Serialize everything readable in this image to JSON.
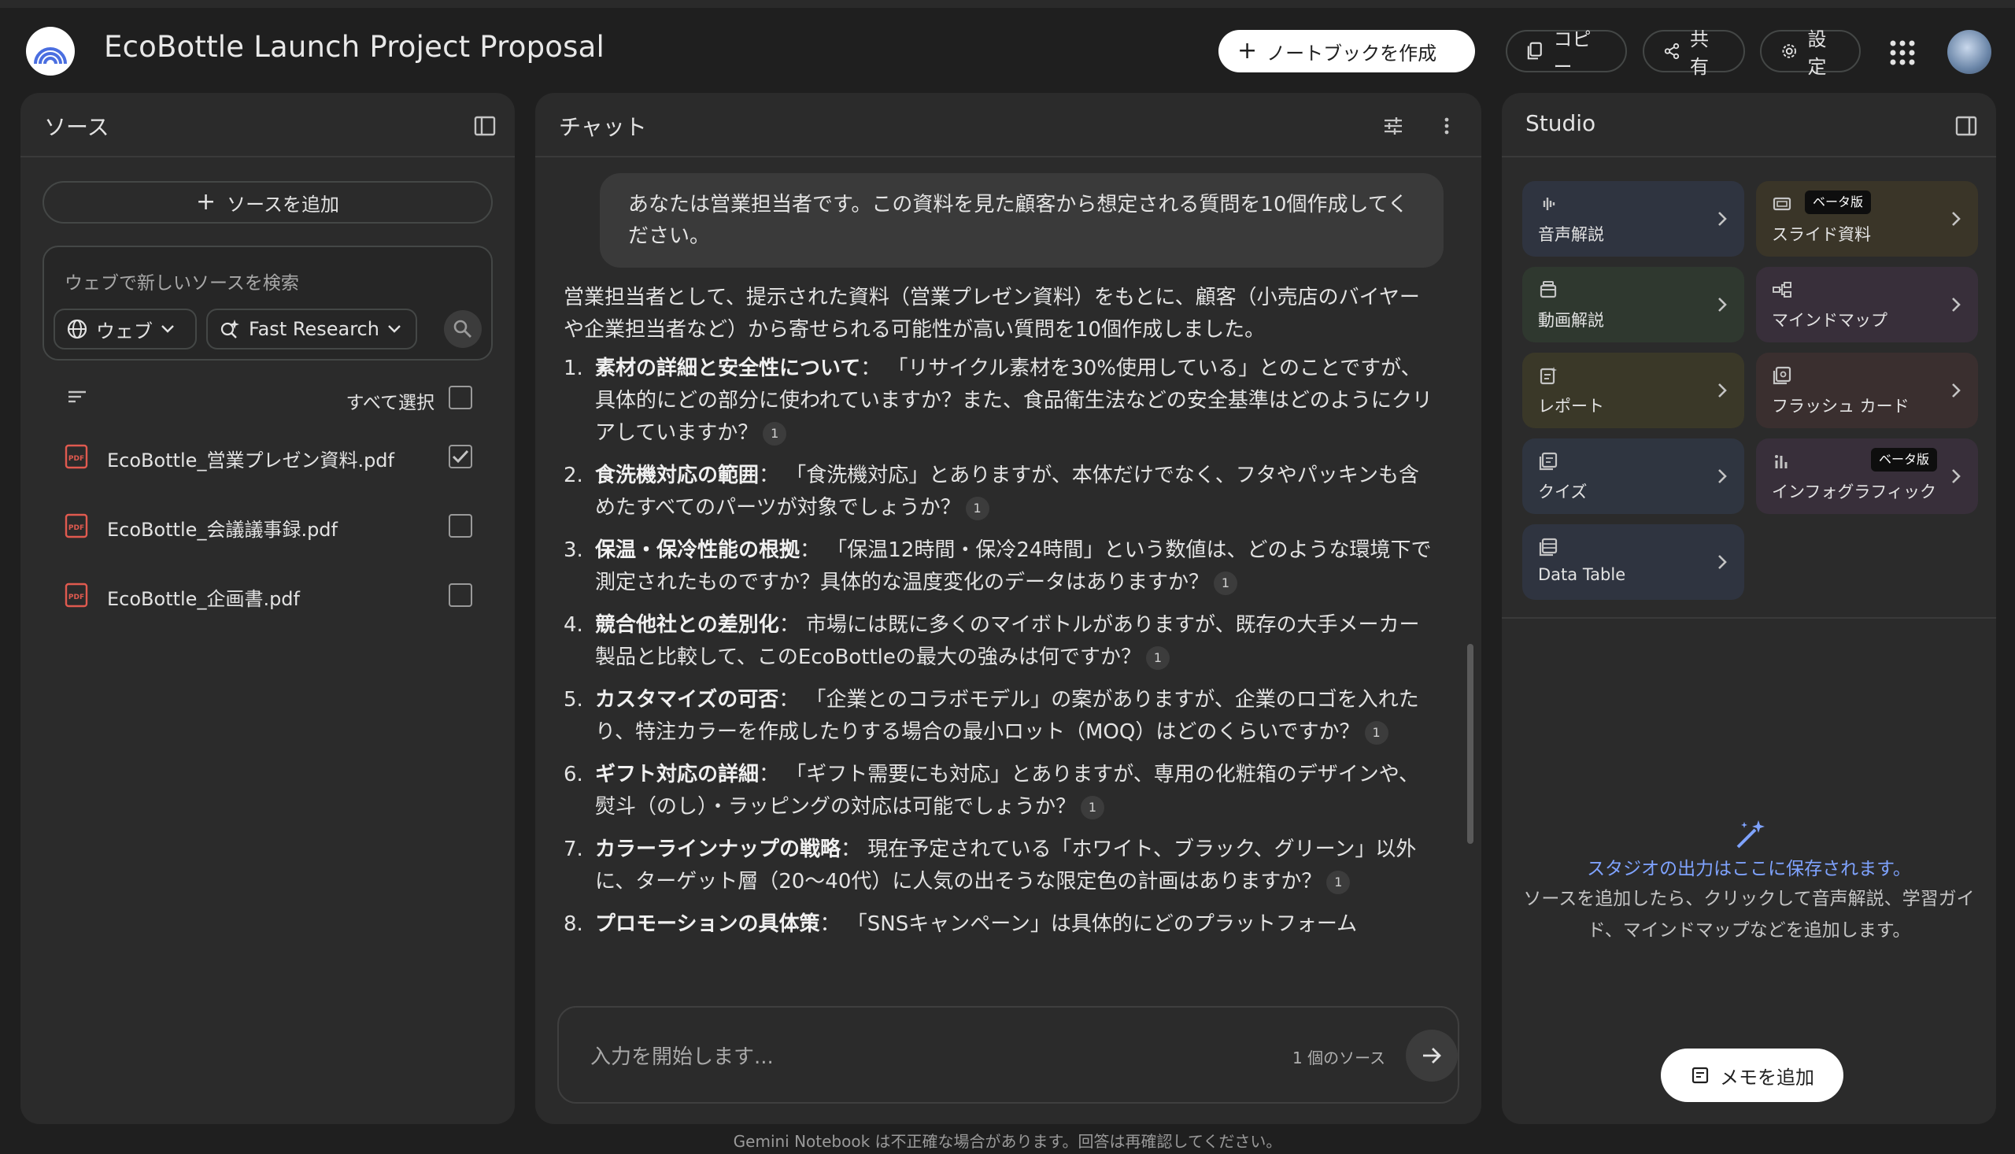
{
  "header": {
    "title": "EcoBottle Launch Project Proposal",
    "create_notebook": "ノートブックを作成",
    "copy": "コピー",
    "share": "共有",
    "settings": "設定"
  },
  "sources": {
    "title": "ソース",
    "add_source": "ソースを追加",
    "search_placeholder": "ウェブで新しいソースを検索",
    "web_chip": "ウェブ",
    "research_chip": "Fast Research",
    "select_all": "すべて選択",
    "items": [
      {
        "name": "EcoBottle_営業プレゼン資料.pdf",
        "checked": true
      },
      {
        "name": "EcoBottle_会議議事録.pdf",
        "checked": false
      },
      {
        "name": "EcoBottle_企画書.pdf",
        "checked": false
      }
    ]
  },
  "chat": {
    "title": "チャット",
    "user_message": "あなたは営業担当者です。この資料を見た顧客から想定される質問を10個作成してください。",
    "intro": "営業担当者として、提示された資料（営業プレゼン資料）をもとに、顧客（小売店のバイヤーや企業担当者など）から寄せられる可能性が高い質問を10個作成しました。",
    "questions": [
      {
        "num": "1.",
        "head": "素材の詳細と安全性について",
        "body": "「リサイクル素材を30%使用している」とのことですが、具体的にどの部分に使われていますか？また、食品衛生法などの安全基準はどのようにクリアしていますか？",
        "cite": "1"
      },
      {
        "num": "2.",
        "head": "食洗機対応の範囲",
        "body": "「食洗機対応」とありますが、本体だけでなく、フタやパッキンも含めたすべてのパーツが対象でしょうか？",
        "cite": "1"
      },
      {
        "num": "3.",
        "head": "保温・保冷性能の根拠",
        "body": "「保温12時間・保冷24時間」という数値は、どのような環境下で測定されたものですか？具体的な温度変化のデータはありますか？",
        "cite": "1"
      },
      {
        "num": "4.",
        "head": "競合他社との差別化",
        "body": "市場には既に多くのマイボトルがありますが、既存の大手メーカー製品と比較して、このEcoBottleの最大の強みは何ですか？",
        "cite": "1"
      },
      {
        "num": "5.",
        "head": "カスタマイズの可否",
        "body": "「企業とのコラボモデル」の案がありますが、企業のロゴを入れたり、特注カラーを作成したりする場合の最小ロット（MOQ）はどのくらいですか？",
        "cite": "1"
      },
      {
        "num": "6.",
        "head": "ギフト対応の詳細",
        "body": "「ギフト需要にも対応」とありますが、専用の化粧箱のデザインや、熨斗（のし）・ラッピングの対応は可能でしょうか？",
        "cite": "1"
      },
      {
        "num": "7.",
        "head": "カラーラインナップの戦略",
        "body": "現在予定されている「ホワイト、ブラック、グリーン」以外に、ターゲット層（20〜40代）に人気の出そうな限定色の計画はありますか？",
        "cite": "1"
      },
      {
        "num": "8.",
        "head": "プロモーションの具体策",
        "body": "「SNSキャンペーン」は具体的にどのプラットフォーム",
        "cite": ""
      }
    ],
    "input_placeholder": "入力を開始します...",
    "source_count": "1 個のソース"
  },
  "studio": {
    "title": "Studio",
    "beta_label": "ベータ版",
    "tiles": [
      {
        "label": "音声解説",
        "icon": "audio-waves-icon",
        "color": "#2f3440",
        "beta": false
      },
      {
        "label": "スライド資料",
        "icon": "slides-icon",
        "color": "#3a3528",
        "beta": true
      },
      {
        "label": "動画解説",
        "icon": "video-icon",
        "color": "#2f382f",
        "beta": false
      },
      {
        "label": "マインドマップ",
        "icon": "mindmap-icon",
        "color": "#382f3a",
        "beta": false
      },
      {
        "label": "レポート",
        "icon": "report-icon",
        "color": "#3a3828",
        "beta": false
      },
      {
        "label": "フラッシュ カード",
        "icon": "flashcard-icon",
        "color": "#3a2f2f",
        "beta": false
      },
      {
        "label": "クイズ",
        "icon": "quiz-icon",
        "color": "#2f3540",
        "beta": false
      },
      {
        "label": "インフォグラフィック",
        "icon": "infographic-icon",
        "color": "#382f3a",
        "beta": true
      },
      {
        "label": "Data Table",
        "icon": "table-icon",
        "color": "#2f3440",
        "beta": false
      }
    ],
    "empty_title": "スタジオの出力はここに保存されます。",
    "empty_desc": "ソースを追加したら、クリックして音声解説、学習ガイド、マインドマップなどを追加します。",
    "add_memo": "メモを追加"
  },
  "footer": {
    "disclaimer": "Gemini Notebook は不正確な場合があります。回答は再確認してください。"
  }
}
